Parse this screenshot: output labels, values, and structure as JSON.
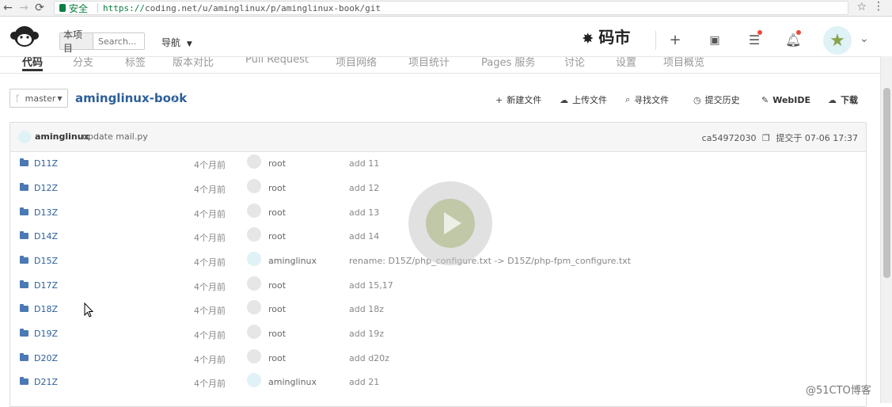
{
  "browser": {
    "secure_label": "安全",
    "url_scheme": "https://",
    "url_rest": "coding.net/u/aminglinux/p/aminglinux-book/git"
  },
  "topnav": {
    "scope_label": "本项目",
    "search_placeholder": "Search...",
    "guide_label": "导航",
    "brand_label": "码市"
  },
  "tabs": [
    "代码",
    "分支",
    "标签",
    "版本对比",
    "Pull Request",
    "项目网络",
    "项目统计",
    "Pages 服务",
    "讨论",
    "设置",
    "项目概览"
  ],
  "repo": {
    "branch": "master",
    "name": "aminglinux-book"
  },
  "actions": [
    {
      "label": "新建文件",
      "icon": "plus-icon"
    },
    {
      "label": "上传文件",
      "icon": "upload-icon"
    },
    {
      "label": "寻找文件",
      "icon": "search-icon"
    },
    {
      "label": "提交历史",
      "icon": "clock-icon"
    },
    {
      "label": "WebIDE",
      "icon": "edit-icon"
    },
    {
      "label": "下载",
      "icon": "download-icon"
    }
  ],
  "latest_commit": {
    "user": "aminglinux",
    "message": "update mail.py",
    "hash": "ca54972030",
    "time": "提交于 07-06 17:37"
  },
  "files": [
    {
      "name": "D11Z",
      "time": "4个月前",
      "author": "root",
      "message": "add 11"
    },
    {
      "name": "D12Z",
      "time": "4个月前",
      "author": "root",
      "message": "add 12"
    },
    {
      "name": "D13Z",
      "time": "4个月前",
      "author": "root",
      "message": "add 13"
    },
    {
      "name": "D14Z",
      "time": "4个月前",
      "author": "root",
      "message": "add 14"
    },
    {
      "name": "D15Z",
      "time": "4个月前",
      "author": "aminglinux",
      "message": "rename: D15Z/php_configure.txt -> D15Z/php-fpm_configure.txt"
    },
    {
      "name": "D17Z",
      "time": "4个月前",
      "author": "root",
      "message": "add 15,17"
    },
    {
      "name": "D18Z",
      "time": "4个月前",
      "author": "root",
      "message": "add 18z"
    },
    {
      "name": "D19Z",
      "time": "4个月前",
      "author": "root",
      "message": "add 19z"
    },
    {
      "name": "D20Z",
      "time": "4个月前",
      "author": "root",
      "message": "add d20z"
    },
    {
      "name": "D21Z",
      "time": "4个月前",
      "author": "aminglinux",
      "message": "add 21"
    }
  ],
  "watermark": "@51CTO博客",
  "colors": {
    "link": "#2d5f9a",
    "secure": "#0b8043",
    "notify": "#e74c3c"
  }
}
